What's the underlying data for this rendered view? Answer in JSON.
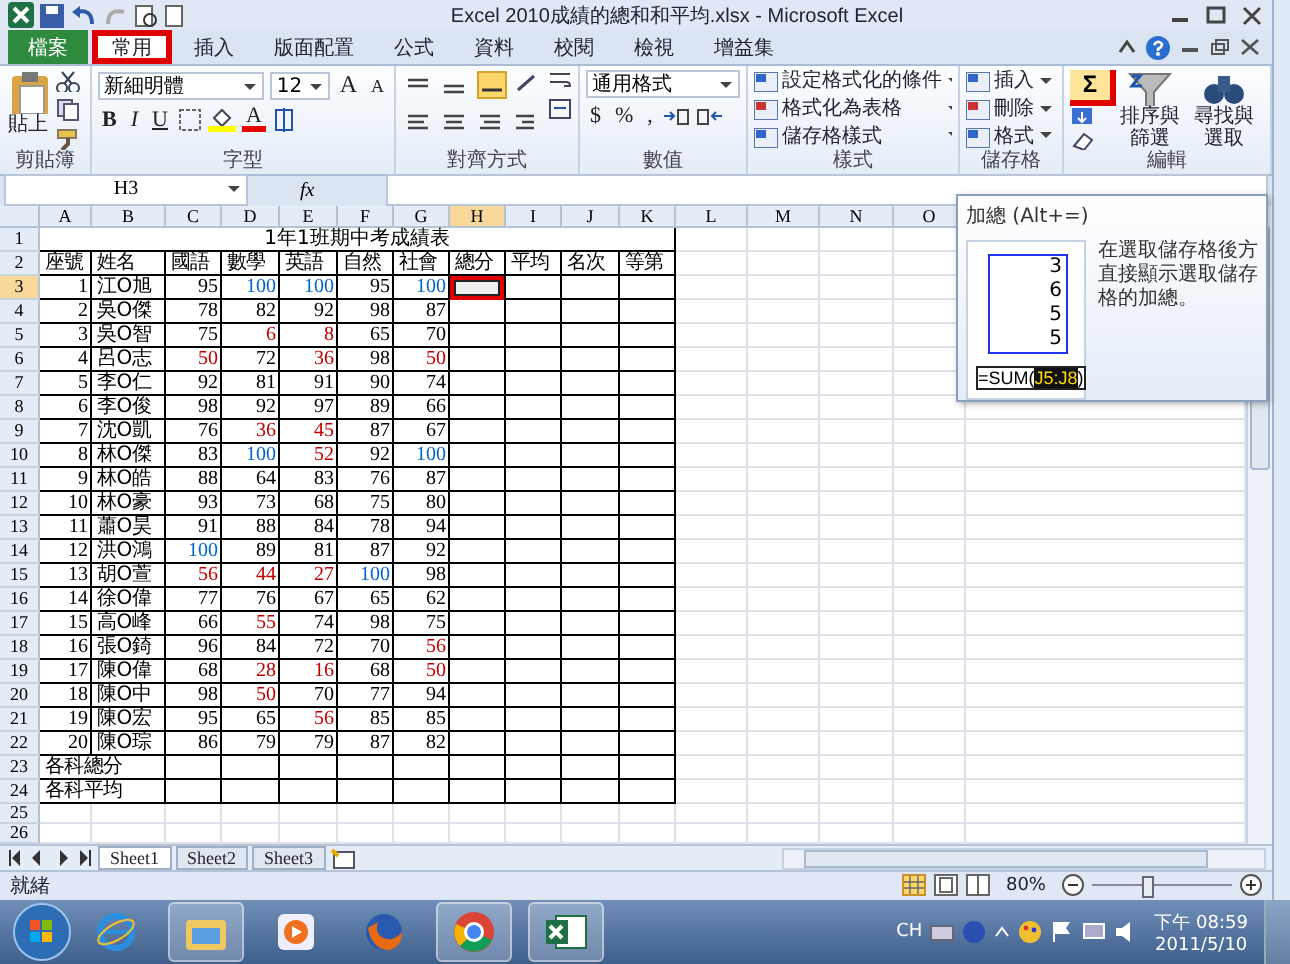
{
  "window": {
    "title": "Excel 2010成績的總和和平均.xlsx - Microsoft Excel"
  },
  "tabs": [
    {
      "label": "檔案",
      "kind": "file",
      "selected": false,
      "highlighted": false
    },
    {
      "label": "常用",
      "kind": "tab",
      "selected": true,
      "highlighted": true
    },
    {
      "label": "插入",
      "kind": "tab",
      "selected": false,
      "highlighted": false
    },
    {
      "label": "版面配置",
      "kind": "tab",
      "selected": false,
      "highlighted": false
    },
    {
      "label": "公式",
      "kind": "tab",
      "selected": false,
      "highlighted": false
    },
    {
      "label": "資料",
      "kind": "tab",
      "selected": false,
      "highlighted": false
    },
    {
      "label": "校閱",
      "kind": "tab",
      "selected": false,
      "highlighted": false
    },
    {
      "label": "檢視",
      "kind": "tab",
      "selected": false,
      "highlighted": false
    },
    {
      "label": "增益集",
      "kind": "tab",
      "selected": false,
      "highlighted": false
    }
  ],
  "ribbon": {
    "groups": [
      {
        "kind": "clipboard",
        "label": "剪貼簿",
        "paste": "貼上"
      },
      {
        "kind": "font",
        "label": "字型",
        "font_name": "新細明體",
        "font_size": "12",
        "grow": "A",
        "shrink": "A",
        "bold": "B",
        "italic": "I",
        "underline": "U",
        "font_color": "A"
      },
      {
        "kind": "alignment",
        "label": "對齊方式"
      },
      {
        "kind": "number",
        "label": "數值",
        "format": "通用格式",
        "currency": "$",
        "percent": "%",
        "comma": ","
      },
      {
        "kind": "styles",
        "label": "樣式",
        "items": [
          "設定格式化的條件",
          "格式化為表格",
          "儲存格樣式"
        ]
      },
      {
        "kind": "cells",
        "label": "儲存格",
        "items": [
          "插入",
          "刪除",
          "格式"
        ]
      },
      {
        "kind": "editing",
        "label": "編輯",
        "sum": "Σ",
        "sum_highlighted": true,
        "sort": "排序與篩選",
        "find": "尋找與選取"
      }
    ]
  },
  "formula_bar": {
    "name_box": "H3",
    "fx": "fx"
  },
  "sheet": {
    "columns": [
      "A",
      "B",
      "C",
      "D",
      "E",
      "F",
      "G",
      "H",
      "I",
      "J",
      "K",
      "L",
      "M",
      "N",
      "O"
    ],
    "row_numbers": [
      "1",
      "2",
      "3",
      "4",
      "5",
      "6",
      "7",
      "8",
      "9",
      "10",
      "11",
      "12",
      "13",
      "14",
      "15",
      "16",
      "17",
      "18",
      "19",
      "20",
      "21",
      "22",
      "23",
      "24",
      "25",
      "26"
    ],
    "title": "1年1班期中考成績表",
    "headers": [
      "座號",
      "姓名",
      "國語",
      "數學",
      "英語",
      "自然",
      "社會",
      "總分",
      "平均",
      "名次",
      "等第"
    ],
    "active_cell_highlighted": true,
    "students": [
      {
        "seat": "1",
        "name": "江O旭",
        "scores": [
          {
            "v": "95",
            "color": "#000000"
          },
          {
            "v": "100",
            "color": "#0066cc"
          },
          {
            "v": "100",
            "color": "#0066cc"
          },
          {
            "v": "95",
            "color": "#000000"
          },
          {
            "v": "100",
            "color": "#0066cc"
          }
        ]
      },
      {
        "seat": "2",
        "name": "吳O傑",
        "scores": [
          {
            "v": "78",
            "color": "#000000"
          },
          {
            "v": "82",
            "color": "#000000"
          },
          {
            "v": "92",
            "color": "#000000"
          },
          {
            "v": "98",
            "color": "#000000"
          },
          {
            "v": "87",
            "color": "#000000"
          }
        ]
      },
      {
        "seat": "3",
        "name": "吳O智",
        "scores": [
          {
            "v": "75",
            "color": "#000000"
          },
          {
            "v": "6",
            "color": "#c00000"
          },
          {
            "v": "8",
            "color": "#c00000"
          },
          {
            "v": "65",
            "color": "#000000"
          },
          {
            "v": "70",
            "color": "#000000"
          }
        ]
      },
      {
        "seat": "4",
        "name": "呂O志",
        "scores": [
          {
            "v": "50",
            "color": "#c00000"
          },
          {
            "v": "72",
            "color": "#000000"
          },
          {
            "v": "36",
            "color": "#c00000"
          },
          {
            "v": "98",
            "color": "#000000"
          },
          {
            "v": "50",
            "color": "#c00000"
          }
        ]
      },
      {
        "seat": "5",
        "name": "李O仁",
        "scores": [
          {
            "v": "92",
            "color": "#000000"
          },
          {
            "v": "81",
            "color": "#000000"
          },
          {
            "v": "91",
            "color": "#000000"
          },
          {
            "v": "90",
            "color": "#000000"
          },
          {
            "v": "74",
            "color": "#000000"
          }
        ]
      },
      {
        "seat": "6",
        "name": "李O俊",
        "scores": [
          {
            "v": "98",
            "color": "#000000"
          },
          {
            "v": "92",
            "color": "#000000"
          },
          {
            "v": "97",
            "color": "#000000"
          },
          {
            "v": "89",
            "color": "#000000"
          },
          {
            "v": "66",
            "color": "#000000"
          }
        ]
      },
      {
        "seat": "7",
        "name": "沈O凱",
        "scores": [
          {
            "v": "76",
            "color": "#000000"
          },
          {
            "v": "36",
            "color": "#c00000"
          },
          {
            "v": "45",
            "color": "#c00000"
          },
          {
            "v": "87",
            "color": "#000000"
          },
          {
            "v": "67",
            "color": "#000000"
          }
        ]
      },
      {
        "seat": "8",
        "name": "林O傑",
        "scores": [
          {
            "v": "83",
            "color": "#000000"
          },
          {
            "v": "100",
            "color": "#0066cc"
          },
          {
            "v": "52",
            "color": "#c00000"
          },
          {
            "v": "92",
            "color": "#000000"
          },
          {
            "v": "100",
            "color": "#0066cc"
          }
        ]
      },
      {
        "seat": "9",
        "name": "林O皓",
        "scores": [
          {
            "v": "88",
            "color": "#000000"
          },
          {
            "v": "64",
            "color": "#000000"
          },
          {
            "v": "83",
            "color": "#000000"
          },
          {
            "v": "76",
            "color": "#000000"
          },
          {
            "v": "87",
            "color": "#000000"
          }
        ]
      },
      {
        "seat": "10",
        "name": "林O豪",
        "scores": [
          {
            "v": "93",
            "color": "#000000"
          },
          {
            "v": "73",
            "color": "#000000"
          },
          {
            "v": "68",
            "color": "#000000"
          },
          {
            "v": "75",
            "color": "#000000"
          },
          {
            "v": "80",
            "color": "#000000"
          }
        ]
      },
      {
        "seat": "11",
        "name": "蕭O昊",
        "scores": [
          {
            "v": "91",
            "color": "#000000"
          },
          {
            "v": "88",
            "color": "#000000"
          },
          {
            "v": "84",
            "color": "#000000"
          },
          {
            "v": "78",
            "color": "#000000"
          },
          {
            "v": "94",
            "color": "#000000"
          }
        ]
      },
      {
        "seat": "12",
        "name": "洪O鴻",
        "scores": [
          {
            "v": "100",
            "color": "#0066cc"
          },
          {
            "v": "89",
            "color": "#000000"
          },
          {
            "v": "81",
            "color": "#000000"
          },
          {
            "v": "87",
            "color": "#000000"
          },
          {
            "v": "92",
            "color": "#000000"
          }
        ]
      },
      {
        "seat": "13",
        "name": "胡O萱",
        "scores": [
          {
            "v": "56",
            "color": "#c00000"
          },
          {
            "v": "44",
            "color": "#c00000"
          },
          {
            "v": "27",
            "color": "#c00000"
          },
          {
            "v": "100",
            "color": "#0066cc"
          },
          {
            "v": "98",
            "color": "#000000"
          }
        ]
      },
      {
        "seat": "14",
        "name": "徐O偉",
        "scores": [
          {
            "v": "77",
            "color": "#000000"
          },
          {
            "v": "76",
            "color": "#000000"
          },
          {
            "v": "67",
            "color": "#000000"
          },
          {
            "v": "65",
            "color": "#000000"
          },
          {
            "v": "62",
            "color": "#000000"
          }
        ]
      },
      {
        "seat": "15",
        "name": "高O峰",
        "scores": [
          {
            "v": "66",
            "color": "#000000"
          },
          {
            "v": "55",
            "color": "#c00000"
          },
          {
            "v": "74",
            "color": "#000000"
          },
          {
            "v": "98",
            "color": "#000000"
          },
          {
            "v": "75",
            "color": "#000000"
          }
        ]
      },
      {
        "seat": "16",
        "name": "張O錡",
        "scores": [
          {
            "v": "96",
            "color": "#000000"
          },
          {
            "v": "84",
            "color": "#000000"
          },
          {
            "v": "72",
            "color": "#000000"
          },
          {
            "v": "70",
            "color": "#000000"
          },
          {
            "v": "56",
            "color": "#c00000"
          }
        ]
      },
      {
        "seat": "17",
        "name": "陳O偉",
        "scores": [
          {
            "v": "68",
            "color": "#000000"
          },
          {
            "v": "28",
            "color": "#c00000"
          },
          {
            "v": "16",
            "color": "#c00000"
          },
          {
            "v": "68",
            "color": "#000000"
          },
          {
            "v": "50",
            "color": "#c00000"
          }
        ]
      },
      {
        "seat": "18",
        "name": "陳O中",
        "scores": [
          {
            "v": "98",
            "color": "#000000"
          },
          {
            "v": "50",
            "color": "#c00000"
          },
          {
            "v": "70",
            "color": "#000000"
          },
          {
            "v": "77",
            "color": "#000000"
          },
          {
            "v": "94",
            "color": "#000000"
          }
        ]
      },
      {
        "seat": "19",
        "name": "陳O宏",
        "scores": [
          {
            "v": "95",
            "color": "#000000"
          },
          {
            "v": "65",
            "color": "#000000"
          },
          {
            "v": "56",
            "color": "#c00000"
          },
          {
            "v": "85",
            "color": "#000000"
          },
          {
            "v": "85",
            "color": "#000000"
          }
        ]
      },
      {
        "seat": "20",
        "name": "陳O琮",
        "scores": [
          {
            "v": "86",
            "color": "#000000"
          },
          {
            "v": "79",
            "color": "#000000"
          },
          {
            "v": "79",
            "color": "#000000"
          },
          {
            "v": "87",
            "color": "#000000"
          },
          {
            "v": "82",
            "color": "#000000"
          }
        ]
      }
    ],
    "summary_rows": [
      "各科總分",
      "各科平均"
    ]
  },
  "sheet_tabs": [
    {
      "label": "Sheet1",
      "selected": true
    },
    {
      "label": "Sheet2",
      "selected": false
    },
    {
      "label": "Sheet3",
      "selected": false
    }
  ],
  "status_bar": {
    "status": "就緒",
    "zoom": "80%",
    "zoom_slider": {
      "level": 0.4
    }
  },
  "tooltip": {
    "title": "加總 (Alt+=)",
    "description": "在選取儲存格後方直接顯示選取儲存格的加總。",
    "example_values": [
      "3",
      "6",
      "5",
      "5"
    ],
    "formula_start": "=SUM(",
    "formula_range": "J5:J8",
    "formula_end": ")"
  },
  "taskbar": {
    "apps": [
      {
        "kind": "browser-e",
        "running": false
      },
      {
        "kind": "folder",
        "running": true
      },
      {
        "kind": "media",
        "running": false
      },
      {
        "kind": "fox",
        "running": false
      },
      {
        "kind": "chrome",
        "running": true
      },
      {
        "kind": "excel",
        "running": true
      }
    ],
    "language": "CH",
    "time": "下午 08:59",
    "date": "2011/5/10"
  }
}
